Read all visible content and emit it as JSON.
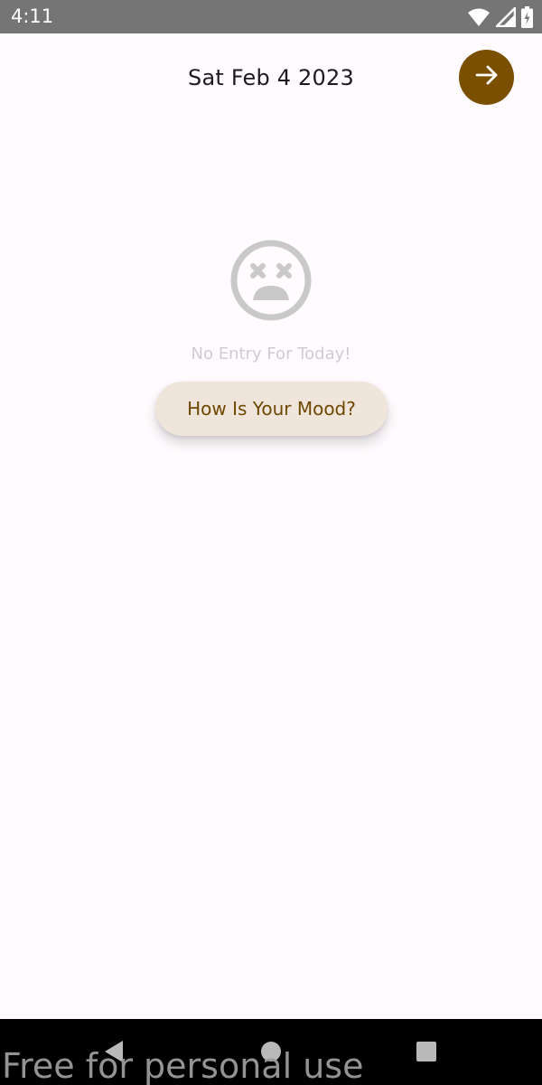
{
  "status_bar": {
    "time": "4:11",
    "icons": [
      "wifi-icon",
      "cellular-signal-icon",
      "battery-charging-icon"
    ]
  },
  "header": {
    "date": "Sat Feb 4 2023",
    "next_icon": "arrow-right-icon",
    "next_button_color": "#7b4f00"
  },
  "empty_state": {
    "icon": "dizzy-face-icon",
    "message": "No Entry For Today!",
    "button_label": "How Is Your Mood?"
  },
  "nav_bar": {
    "icons": [
      "back-icon",
      "home-icon",
      "recents-icon"
    ]
  },
  "watermark": {
    "text": "Free for personal use"
  },
  "colors": {
    "background": "#fffbfe",
    "accent": "#7b4f00",
    "button_bg": "#efe5db",
    "muted_text": "#cfcbcf"
  }
}
